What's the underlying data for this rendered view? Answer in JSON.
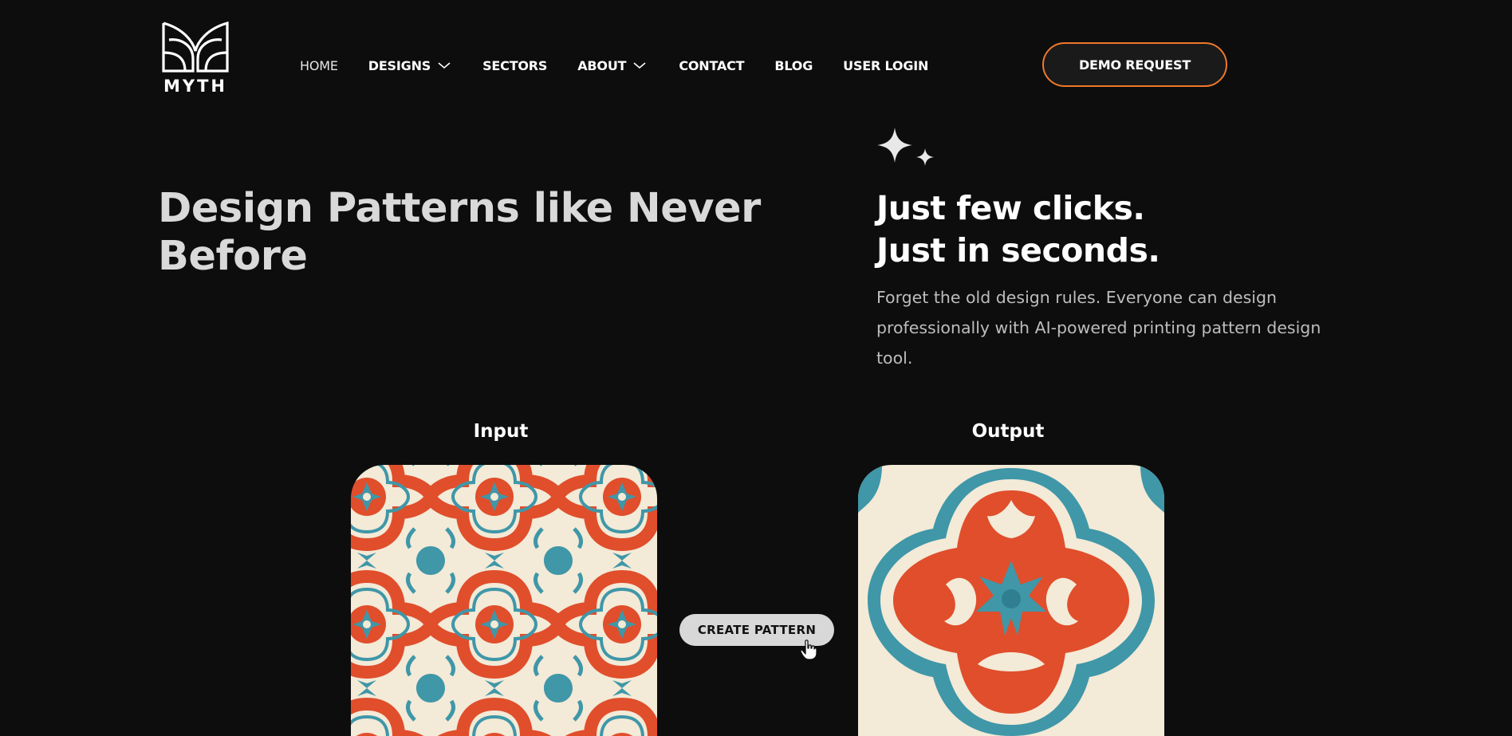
{
  "brand": {
    "name": "MYTH",
    "logo_icon": "myth-monogram-icon"
  },
  "nav": {
    "items": [
      {
        "label": "HOME",
        "active": true,
        "has_dropdown": false
      },
      {
        "label": "DESIGNS",
        "active": false,
        "has_dropdown": true
      },
      {
        "label": "SECTORS",
        "active": false,
        "has_dropdown": false
      },
      {
        "label": "ABOUT",
        "active": false,
        "has_dropdown": true
      },
      {
        "label": "CONTACT",
        "active": false,
        "has_dropdown": false
      },
      {
        "label": "BLOG",
        "active": false,
        "has_dropdown": false
      },
      {
        "label": "USER LOGIN",
        "active": false,
        "has_dropdown": false
      }
    ],
    "cta_label": "DEMO REQUEST"
  },
  "hero": {
    "title": "Design Patterns like Never Before",
    "tagline_line1": "Just few clicks.",
    "tagline_line2": "Just in seconds.",
    "description": "Forget the old design rules. Everyone can design professionally with AI-powered printing pattern design tool.",
    "sparkle_icon": "sparkle-icon"
  },
  "demo": {
    "input_label": "Input",
    "output_label": "Output",
    "create_button_label": "CREATE PATTERN",
    "cursor_icon": "hand-pointer-icon"
  },
  "colors": {
    "background": "#0d0d0d",
    "accent_orange": "#f0782a",
    "pattern_red": "#e04e2c",
    "pattern_teal": "#3f97a8",
    "pattern_cream": "#f3ead7"
  }
}
